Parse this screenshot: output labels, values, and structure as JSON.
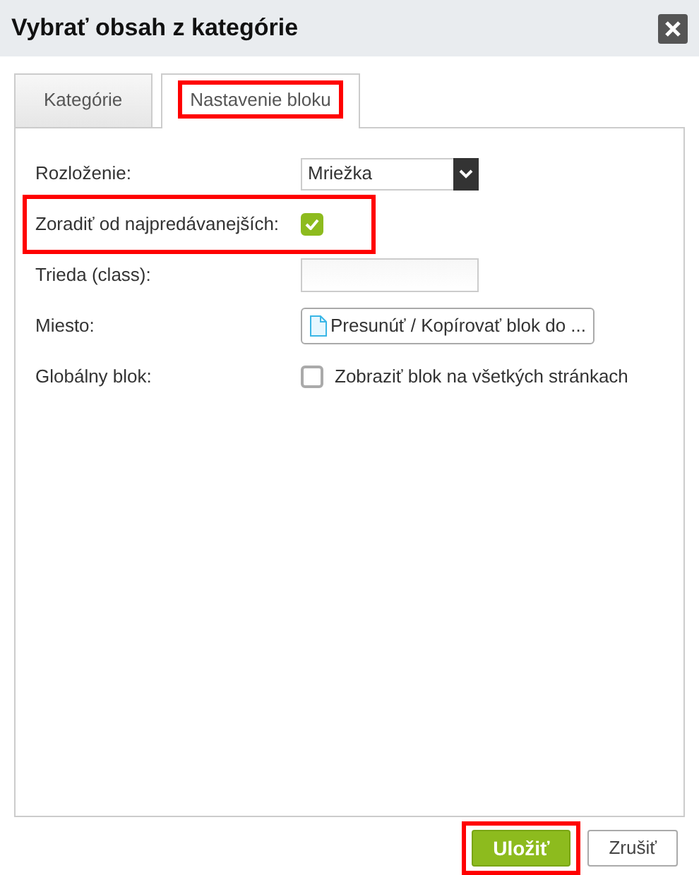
{
  "window": {
    "title": "Vybrať obsah z kategórie"
  },
  "tabs": [
    {
      "label": "Kategórie",
      "selected": false,
      "highlighted": false
    },
    {
      "label": "Nastavenie bloku",
      "selected": true,
      "highlighted": true
    }
  ],
  "fields": [
    {
      "label": "Rozloženie:",
      "kind": "select",
      "value": "Mriežka",
      "highlighted": false
    },
    {
      "label": "Zoradiť od najpredávanejších:",
      "kind": "checkbox",
      "checked": true,
      "highlighted": true
    },
    {
      "label": "Trieda (class):",
      "kind": "text",
      "highlighted": false
    },
    {
      "label": "Miesto:",
      "kind": "button",
      "value": "Presunúť / Kopírovať blok do ...",
      "highlighted": false
    },
    {
      "label": "Globálny blok:",
      "kind": "checkbox",
      "checked": false,
      "text": "Zobraziť blok na všetkých stránkach",
      "highlighted": false
    }
  ],
  "buttons": [
    {
      "label": "Uložiť",
      "kind": "primary",
      "highlighted": true
    },
    {
      "label": "Zrušiť",
      "kind": "secondary",
      "highlighted": false
    }
  ]
}
